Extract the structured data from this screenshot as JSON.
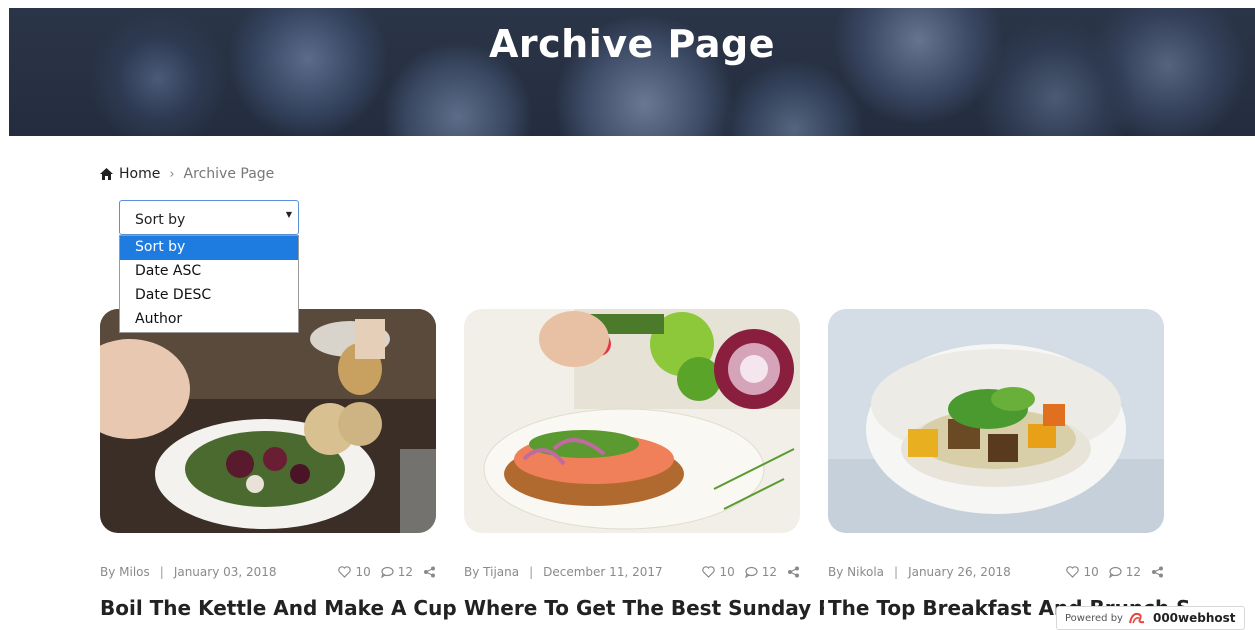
{
  "hero": {
    "title": "Archive Page"
  },
  "breadcrumb": {
    "home": "Home",
    "separator": "›",
    "current": "Archive Page"
  },
  "sort": {
    "selected": "Sort by",
    "options": [
      "Sort by",
      "Date ASC",
      "Date DESC",
      "Author"
    ]
  },
  "posts": [
    {
      "author": "By Milos",
      "date": "January 03, 2018",
      "likes": "10",
      "comments": "12",
      "title": "Boil The Kettle And Make A Cup Of Tea Folks, This Is Going To"
    },
    {
      "author": "By Tijana",
      "date": "December 11, 2017",
      "likes": "10",
      "comments": "12",
      "title": "Where To Get The Best Sunday Roast In The Cotswolds"
    },
    {
      "author": "By Nikola",
      "date": "January 26, 2018",
      "likes": "10",
      "comments": "12",
      "title": "The Top Breakfast And Brunch Spots In Hove, Brighton"
    }
  ],
  "powered_by": {
    "label": "Powered by",
    "brand": "000webhost"
  },
  "colors": {
    "dropdown_highlight": "#1e7be0",
    "select_border": "#5b8fd6",
    "hero_bg": "#2b3548"
  },
  "icons": [
    "home-icon",
    "heart-icon",
    "comment-icon",
    "share-icon",
    "chevron-down-icon",
    "webhost-logo-icon"
  ]
}
